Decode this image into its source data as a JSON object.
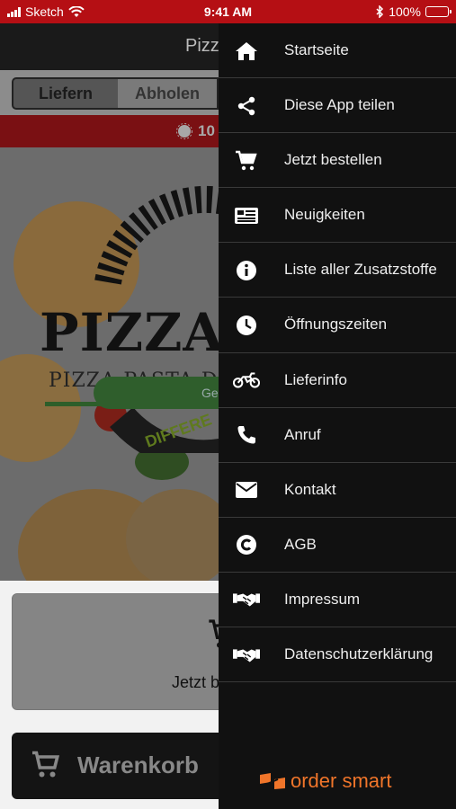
{
  "status_bar": {
    "carrier": "Sketch",
    "time": "9:41 AM",
    "battery": "100%"
  },
  "app": {
    "title": "Pizz",
    "tabs": [
      {
        "label": "Liefern",
        "active": true
      },
      {
        "label": "Abholen",
        "active": false
      }
    ],
    "promo_text": "10",
    "logo_title": "PIZZA",
    "logo_subtitle": "PIZZA-PASTA-DO",
    "logo_ring_text": "DIFFERE",
    "hero_button_label": "Ge",
    "order_label": "Jetzt b",
    "cart_label": "Warenkorb"
  },
  "drawer": {
    "items": [
      {
        "label": "Startseite",
        "icon": "home-icon"
      },
      {
        "label": "Diese App teilen",
        "icon": "share-icon"
      },
      {
        "label": "Jetzt bestellen",
        "icon": "cart-icon"
      },
      {
        "label": "Neuigkeiten",
        "icon": "news-icon"
      },
      {
        "label": "Liste aller Zusatzstoffe",
        "icon": "info-icon"
      },
      {
        "label": "Öffnungszeiten",
        "icon": "clock-icon"
      },
      {
        "label": "Lieferinfo",
        "icon": "motorbike-icon"
      },
      {
        "label": "Anruf",
        "icon": "phone-icon"
      },
      {
        "label": "Kontakt",
        "icon": "mail-icon"
      },
      {
        "label": "AGB",
        "icon": "copyright-icon"
      },
      {
        "label": "Impressum",
        "icon": "handshake-icon"
      },
      {
        "label": "Datenschutzerklärung",
        "icon": "handshake-icon"
      }
    ],
    "brand": "order smart"
  },
  "colors": {
    "status_bar": "#b50f14",
    "drawer_bg": "#111111",
    "brand_orange": "#f0752a"
  }
}
